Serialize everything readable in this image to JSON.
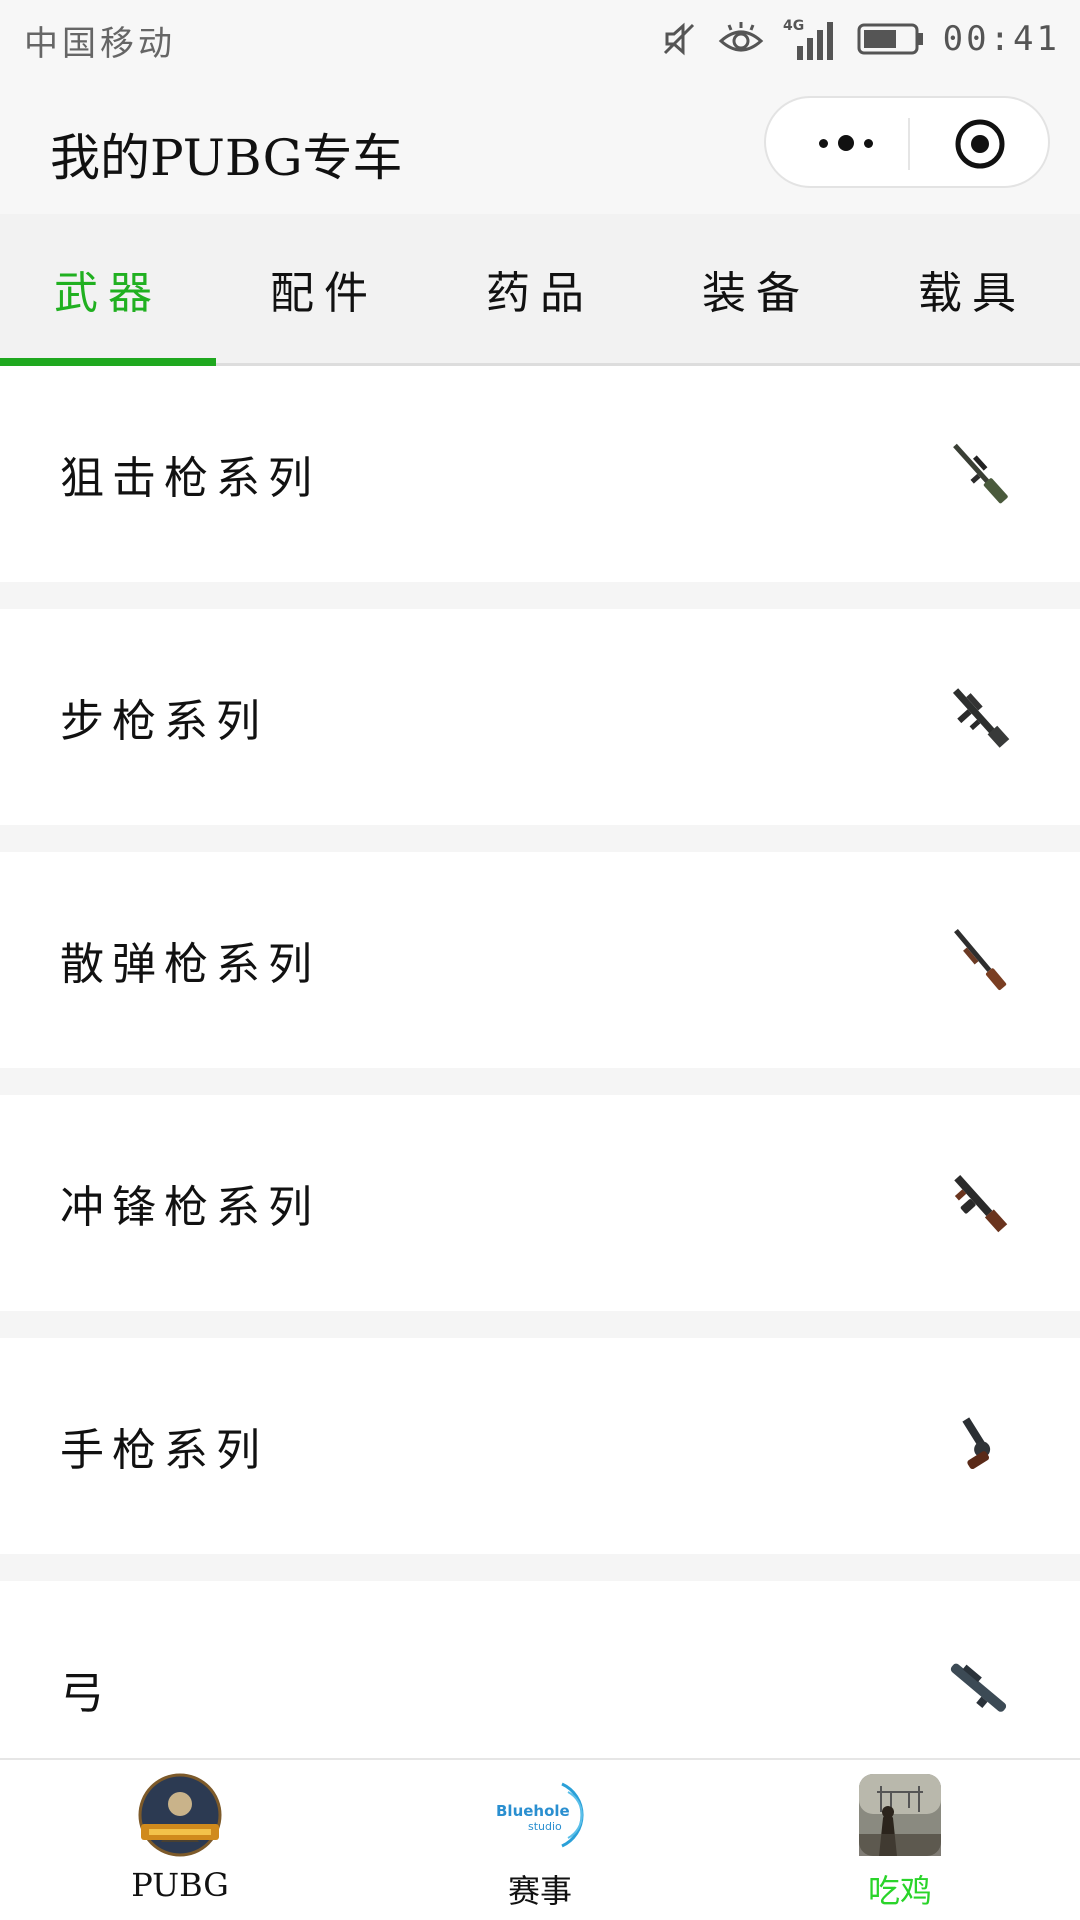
{
  "status_bar": {
    "carrier": "中国移动",
    "network": "4G",
    "time": "00:41"
  },
  "header": {
    "title": "我的PUBG专车"
  },
  "tabs": [
    {
      "label": "武器",
      "active": true
    },
    {
      "label": "配件",
      "active": false
    },
    {
      "label": "药品",
      "active": false
    },
    {
      "label": "装备",
      "active": false
    },
    {
      "label": "载具",
      "active": false
    }
  ],
  "weapon_categories": [
    {
      "label": "狙击枪系列",
      "icon": "sniper-rifle-icon"
    },
    {
      "label": "步枪系列",
      "icon": "assault-rifle-icon"
    },
    {
      "label": "散弹枪系列",
      "icon": "shotgun-icon"
    },
    {
      "label": "冲锋枪系列",
      "icon": "smg-icon"
    },
    {
      "label": "手枪系列",
      "icon": "pistol-icon"
    },
    {
      "label": "弓",
      "icon": "crossbow-icon"
    }
  ],
  "bottom_nav": [
    {
      "label": "PUBG",
      "icon": "pubg-logo-icon",
      "active": false
    },
    {
      "label": "赛事",
      "icon": "bluehole-logo-icon",
      "active": false,
      "logo_text": "Bluehole",
      "logo_subtext": "studio"
    },
    {
      "label": "吃鸡",
      "icon": "chicken-dinner-icon",
      "active": true
    }
  ],
  "colors": {
    "accent": "#1fa81f",
    "active_nav_text": "#2ad42a",
    "background": "#f5f5f5"
  }
}
